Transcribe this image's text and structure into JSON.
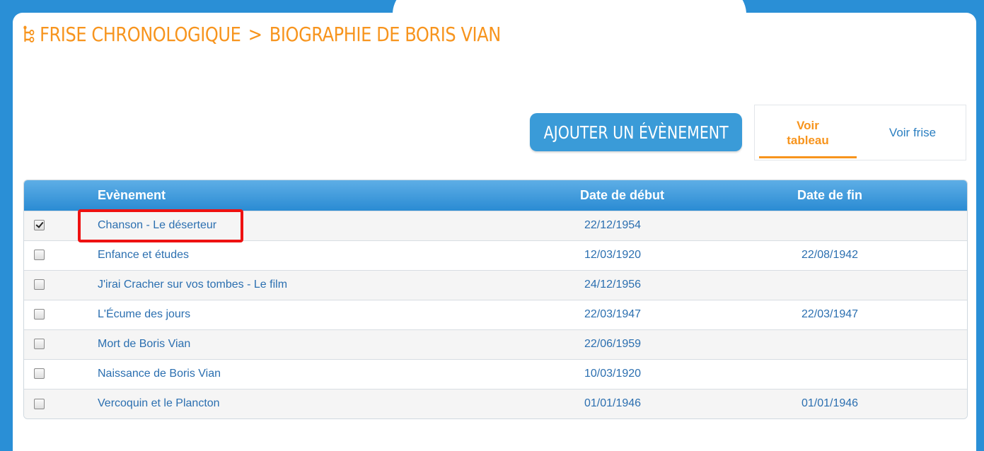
{
  "header": {
    "breadcrumb_root": "FRISE CHRONOLOGIQUE",
    "separator": ">",
    "breadcrumb_current": "BIOGRAPHIE DE BORIS VIAN"
  },
  "toolbar": {
    "add_event_label": "AJOUTER UN ÉVÈNEMENT",
    "view_table_label_line1": "Voir",
    "view_table_label_line2": "tableau",
    "view_timeline_label": "Voir frise"
  },
  "table": {
    "headers": {
      "event": "Evènement",
      "start_date": "Date de début",
      "end_date": "Date de fin"
    },
    "rows": [
      {
        "checked": true,
        "event": "Chanson - Le déserteur",
        "start": "22/12/1954",
        "end": ""
      },
      {
        "checked": false,
        "event": "Enfance et études",
        "start": "12/03/1920",
        "end": "22/08/1942"
      },
      {
        "checked": false,
        "event": "J'irai Cracher sur vos tombes - Le film",
        "start": "24/12/1956",
        "end": ""
      },
      {
        "checked": false,
        "event": "L'Écume des jours",
        "start": "22/03/1947",
        "end": "22/03/1947"
      },
      {
        "checked": false,
        "event": "Mort de Boris Vian",
        "start": "22/06/1959",
        "end": ""
      },
      {
        "checked": false,
        "event": "Naissance de Boris Vian",
        "start": "10/03/1920",
        "end": ""
      },
      {
        "checked": false,
        "event": "Vercoquin et le Plancton",
        "start": "01/01/1946",
        "end": "01/01/1946"
      }
    ]
  },
  "colors": {
    "accent_orange": "#f7941d",
    "brand_blue": "#2a8fd6",
    "link_blue": "#2b6fb0",
    "highlight_red": "#ee1111"
  },
  "icons": {
    "title_icon": "timeline-tree-icon"
  }
}
